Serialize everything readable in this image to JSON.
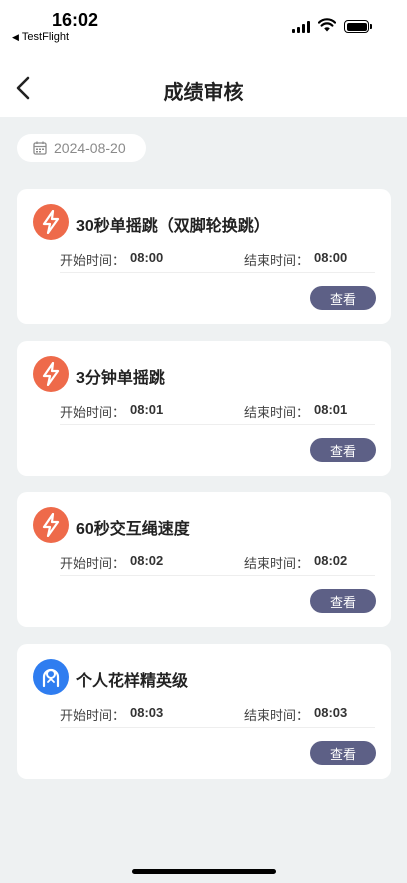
{
  "status_bar": {
    "time": "16:02",
    "back_app": "TestFlight"
  },
  "header": {
    "title": "成绩审核"
  },
  "date_filter": {
    "date": "2024-08-20"
  },
  "cards": [
    {
      "icon": "lightning-icon",
      "title": "30秒单摇跳（双脚轮换跳）",
      "start_label": "开始时间：",
      "start_time": "08:00",
      "end_label": "结束时间：",
      "end_time": "08:00",
      "button": "查看"
    },
    {
      "icon": "lightning-icon",
      "title": "3分钟单摇跳",
      "start_label": "开始时间：",
      "start_time": "08:01",
      "end_label": "结束时间：",
      "end_time": "08:01",
      "button": "查看"
    },
    {
      "icon": "lightning-icon",
      "title": "60秒交互绳速度",
      "start_label": "开始时间：",
      "start_time": "08:02",
      "end_label": "结束时间：",
      "end_time": "08:02",
      "button": "查看"
    },
    {
      "icon": "headset-person-icon",
      "title": "个人花样精英级",
      "start_label": "开始时间：",
      "start_time": "08:03",
      "end_label": "结束时间：",
      "end_time": "08:03",
      "button": "查看"
    }
  ],
  "colors": {
    "accent_orange": "#ee6a4a",
    "accent_blue": "#2f7df0",
    "button": "#5d6086",
    "background": "#eef1f2"
  }
}
